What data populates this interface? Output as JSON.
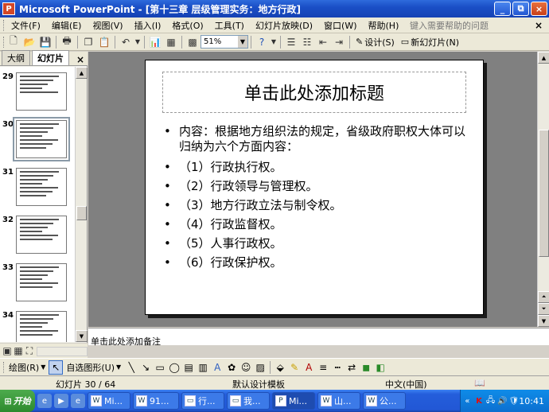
{
  "window": {
    "title": "Microsoft PowerPoint - [第十三章 层级管理实务：地方行政]",
    "app_icon": "P",
    "buttons": [
      "_",
      "⧉",
      "×"
    ]
  },
  "menu": {
    "items": [
      "文件(F)",
      "编辑(E)",
      "视图(V)",
      "插入(I)",
      "格式(O)",
      "工具(T)",
      "幻灯片放映(D)",
      "窗口(W)",
      "帮助(H)"
    ],
    "help_placeholder": "键入需要帮助的问题",
    "close": "×"
  },
  "toolbar": {
    "zoom": "51%",
    "design_label": "设计(S)",
    "new_slide_label": "新幻灯片(N)"
  },
  "left_panel": {
    "tabs": [
      "大纲",
      "幻灯片"
    ],
    "close": "×",
    "slides": [
      {
        "num": "29",
        "lines": 5
      },
      {
        "num": "30",
        "lines": 7,
        "selected": true
      },
      {
        "num": "31",
        "lines": 7
      },
      {
        "num": "32",
        "lines": 6
      },
      {
        "num": "33",
        "lines": 6
      },
      {
        "num": "34",
        "lines": 6
      }
    ]
  },
  "slide": {
    "title_placeholder": "单击此处添加标题",
    "bullets": [
      "内容：根据地方组织法的规定，省级政府职权大体可以归纳为六个方面内容：",
      "（1）行政执行权。",
      "（2）行政领导与管理权。",
      "（3）地方行政立法与制令权。",
      "（4）行政监督权。",
      "（5）人事行政权。",
      "（6）行政保护权。"
    ]
  },
  "notes": {
    "placeholder": "单击此处添加备注"
  },
  "draw_toolbar": {
    "draw_label": "绘图(R)",
    "autoshape_label": "自选图形(U)"
  },
  "status": {
    "slide_info": "幻灯片 30 / 64",
    "design": "默认设计模板",
    "language": "中文(中国)"
  },
  "taskbar": {
    "start": "开始",
    "tasks": [
      "Mi...",
      "91...",
      "行...",
      "我...",
      "Mi...",
      "山...",
      "公..."
    ],
    "active_task_index": 4,
    "clock": "10:41"
  }
}
